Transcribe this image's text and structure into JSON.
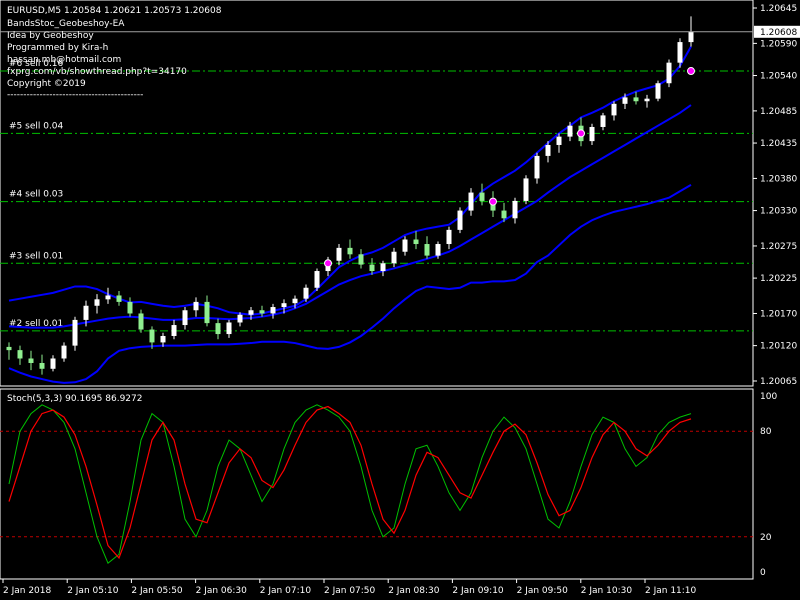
{
  "header": {
    "symbol_line": "EURUSD,M5  1.20584 1.20621 1.20573 1.20608",
    "ea_name": "BandsStoc_Geobeshoy-EA",
    "idea": "Idea by Geobeshoy",
    "programmer": "Programmed by Kira-h",
    "email": "hassan.mb@hotmail.com",
    "forum_link": "fxprg.com/vb/showthread.php?t=34170",
    "copyright": "Copyright ©2019",
    "separator": "------------------------------------------"
  },
  "current_price_label": "1.20608",
  "price_axis_labels": [
    "1.20645",
    "1.20590",
    "1.20540",
    "1.20485",
    "1.20435",
    "1.20380",
    "1.20330",
    "1.20275",
    "1.20225",
    "1.20170",
    "1.20120",
    "1.20065"
  ],
  "sell_levels": [
    {
      "label": "#6 sell 0.16",
      "price": 1.20547
    },
    {
      "label": "#5 sell 0.04",
      "price": 1.2045
    },
    {
      "label": "#4 sell 0.03",
      "price": 1.20344
    },
    {
      "label": "#3 sell 0.01",
      "price": 1.20248
    },
    {
      "label": "#2 sell 0.01",
      "price": 1.20143
    }
  ],
  "indicator": {
    "title": "Stoch(5,3,3) 90.1695 86.9272",
    "axis_labels": [
      "100",
      "80",
      "20",
      "0"
    ],
    "levels": [
      80,
      20
    ]
  },
  "time_axis_labels": [
    "2 Jan 2018",
    "2 Jan 05:10",
    "2 Jan 05:50",
    "2 Jan 06:30",
    "2 Jan 07:10",
    "2 Jan 07:50",
    "2 Jan 08:30",
    "2 Jan 09:10",
    "2 Jan 09:50",
    "2 Jan 10:30",
    "2 Jan 11:10"
  ],
  "colors": {
    "background": "#000000",
    "bull_candle": "#ffffff",
    "bear_candle": "#90ee90",
    "bands": "#0000ff",
    "levels": "#00c000",
    "stoch_main": "#00c000",
    "stoch_signal": "#ff0000",
    "signal_marker": "#ff00ff"
  },
  "chart_data": {
    "type": "candlestick",
    "candles": [
      {
        "o": 1.20118,
        "h": 1.20125,
        "l": 1.20098,
        "c": 1.20113
      },
      {
        "o": 1.20113,
        "h": 1.2012,
        "l": 1.2009,
        "c": 1.201
      },
      {
        "o": 1.201,
        "h": 1.20112,
        "l": 1.20082,
        "c": 1.20093
      },
      {
        "o": 1.20093,
        "h": 1.20106,
        "l": 1.20075,
        "c": 1.20084
      },
      {
        "o": 1.20084,
        "h": 1.20105,
        "l": 1.2008,
        "c": 1.201
      },
      {
        "o": 1.201,
        "h": 1.20125,
        "l": 1.20095,
        "c": 1.2012
      },
      {
        "o": 1.2012,
        "h": 1.20165,
        "l": 1.20112,
        "c": 1.2016
      },
      {
        "o": 1.2016,
        "h": 1.2019,
        "l": 1.2015,
        "c": 1.20182
      },
      {
        "o": 1.20182,
        "h": 1.202,
        "l": 1.2017,
        "c": 1.20192
      },
      {
        "o": 1.20192,
        "h": 1.2021,
        "l": 1.20185,
        "c": 1.20198
      },
      {
        "o": 1.20198,
        "h": 1.20205,
        "l": 1.20182,
        "c": 1.20188
      },
      {
        "o": 1.20188,
        "h": 1.20195,
        "l": 1.20165,
        "c": 1.2017
      },
      {
        "o": 1.2017,
        "h": 1.20176,
        "l": 1.2014,
        "c": 1.20145
      },
      {
        "o": 1.20145,
        "h": 1.2015,
        "l": 1.20115,
        "c": 1.20125
      },
      {
        "o": 1.20125,
        "h": 1.2014,
        "l": 1.20118,
        "c": 1.20135
      },
      {
        "o": 1.20135,
        "h": 1.2016,
        "l": 1.2013,
        "c": 1.20152
      },
      {
        "o": 1.20152,
        "h": 1.2018,
        "l": 1.20145,
        "c": 1.20175
      },
      {
        "o": 1.20175,
        "h": 1.20195,
        "l": 1.20165,
        "c": 1.20188
      },
      {
        "o": 1.20188,
        "h": 1.20198,
        "l": 1.2015,
        "c": 1.20155
      },
      {
        "o": 1.20155,
        "h": 1.20162,
        "l": 1.2013,
        "c": 1.20138
      },
      {
        "o": 1.20138,
        "h": 1.2016,
        "l": 1.20132,
        "c": 1.20156
      },
      {
        "o": 1.20156,
        "h": 1.20172,
        "l": 1.2015,
        "c": 1.20168
      },
      {
        "o": 1.20168,
        "h": 1.2018,
        "l": 1.2016,
        "c": 1.20175
      },
      {
        "o": 1.20175,
        "h": 1.20182,
        "l": 1.20165,
        "c": 1.2017
      },
      {
        "o": 1.2017,
        "h": 1.20185,
        "l": 1.20162,
        "c": 1.2018
      },
      {
        "o": 1.2018,
        "h": 1.20192,
        "l": 1.2017,
        "c": 1.20186
      },
      {
        "o": 1.20186,
        "h": 1.20198,
        "l": 1.20178,
        "c": 1.20193
      },
      {
        "o": 1.20193,
        "h": 1.20215,
        "l": 1.20188,
        "c": 1.2021
      },
      {
        "o": 1.2021,
        "h": 1.2024,
        "l": 1.20205,
        "c": 1.20236
      },
      {
        "o": 1.20236,
        "h": 1.20258,
        "l": 1.20228,
        "c": 1.20252
      },
      {
        "o": 1.20252,
        "h": 1.20278,
        "l": 1.20245,
        "c": 1.20272
      },
      {
        "o": 1.20272,
        "h": 1.20285,
        "l": 1.20255,
        "c": 1.20262
      },
      {
        "o": 1.20262,
        "h": 1.2027,
        "l": 1.2024,
        "c": 1.20246
      },
      {
        "o": 1.20246,
        "h": 1.20256,
        "l": 1.2023,
        "c": 1.20236
      },
      {
        "o": 1.20236,
        "h": 1.20252,
        "l": 1.20228,
        "c": 1.20248
      },
      {
        "o": 1.20248,
        "h": 1.20272,
        "l": 1.20242,
        "c": 1.20266
      },
      {
        "o": 1.20266,
        "h": 1.2029,
        "l": 1.2026,
        "c": 1.20285
      },
      {
        "o": 1.20285,
        "h": 1.20298,
        "l": 1.2027,
        "c": 1.20278
      },
      {
        "o": 1.20278,
        "h": 1.2029,
        "l": 1.20255,
        "c": 1.2026
      },
      {
        "o": 1.2026,
        "h": 1.20282,
        "l": 1.20255,
        "c": 1.20278
      },
      {
        "o": 1.20278,
        "h": 1.20305,
        "l": 1.2027,
        "c": 1.203
      },
      {
        "o": 1.203,
        "h": 1.20335,
        "l": 1.20295,
        "c": 1.2033
      },
      {
        "o": 1.2033,
        "h": 1.20365,
        "l": 1.20322,
        "c": 1.20358
      },
      {
        "o": 1.20358,
        "h": 1.20372,
        "l": 1.20338,
        "c": 1.20345
      },
      {
        "o": 1.20345,
        "h": 1.2036,
        "l": 1.2032,
        "c": 1.2033
      },
      {
        "o": 1.2033,
        "h": 1.20342,
        "l": 1.20312,
        "c": 1.20318
      },
      {
        "o": 1.20318,
        "h": 1.2035,
        "l": 1.2031,
        "c": 1.20345
      },
      {
        "o": 1.20345,
        "h": 1.20385,
        "l": 1.2034,
        "c": 1.2038
      },
      {
        "o": 1.2038,
        "h": 1.2042,
        "l": 1.20372,
        "c": 1.20415
      },
      {
        "o": 1.20415,
        "h": 1.20438,
        "l": 1.20405,
        "c": 1.20432
      },
      {
        "o": 1.20432,
        "h": 1.2045,
        "l": 1.2042,
        "c": 1.20445
      },
      {
        "o": 1.20445,
        "h": 1.20468,
        "l": 1.20438,
        "c": 1.20462
      },
      {
        "o": 1.20462,
        "h": 1.20475,
        "l": 1.2043,
        "c": 1.20438
      },
      {
        "o": 1.20438,
        "h": 1.20465,
        "l": 1.20432,
        "c": 1.2046
      },
      {
        "o": 1.2046,
        "h": 1.20482,
        "l": 1.20455,
        "c": 1.20478
      },
      {
        "o": 1.20478,
        "h": 1.205,
        "l": 1.2047,
        "c": 1.20496
      },
      {
        "o": 1.20496,
        "h": 1.20512,
        "l": 1.20488,
        "c": 1.20506
      },
      {
        "o": 1.20506,
        "h": 1.20515,
        "l": 1.20495,
        "c": 1.205
      },
      {
        "o": 1.205,
        "h": 1.2051,
        "l": 1.2049,
        "c": 1.20504
      },
      {
        "o": 1.20504,
        "h": 1.20532,
        "l": 1.205,
        "c": 1.20528
      },
      {
        "o": 1.20528,
        "h": 1.20565,
        "l": 1.20522,
        "c": 1.2056
      },
      {
        "o": 1.2056,
        "h": 1.20598,
        "l": 1.20552,
        "c": 1.20592
      },
      {
        "o": 1.20592,
        "h": 1.20632,
        "l": 1.20585,
        "c": 1.20608
      }
    ],
    "bands_upper": [
      1.2019,
      1.20193,
      1.20196,
      1.20199,
      1.20202,
      1.20207,
      1.20212,
      1.20212,
      1.20208,
      1.202,
      1.20193,
      1.20187,
      1.20188,
      1.20185,
      1.20182,
      1.2018,
      1.20182,
      1.20185,
      1.20182,
      1.20178,
      1.20172,
      1.2017,
      1.20168,
      1.2017,
      1.20174,
      1.20178,
      1.20182,
      1.20192,
      1.20208,
      1.20225,
      1.20242,
      1.20252,
      1.2026,
      1.20265,
      1.20272,
      1.20282,
      1.20292,
      1.20298,
      1.20302,
      1.20305,
      1.20308,
      1.2032,
      1.2034,
      1.2036,
      1.20372,
      1.20382,
      1.20392,
      1.20405,
      1.2042,
      1.20435,
      1.2045,
      1.20462,
      1.20475,
      1.20482,
      1.2049,
      1.205,
      1.20508,
      1.20515,
      1.2052,
      1.20525,
      1.20535,
      1.20555,
      1.20585
    ],
    "bands_middle": [
      1.2015,
      1.20149,
      1.20148,
      1.20148,
      1.20148,
      1.2015,
      1.20153,
      1.20156,
      1.20159,
      1.20162,
      1.20164,
      1.20165,
      1.20164,
      1.20162,
      1.2016,
      1.2016,
      1.20161,
      1.20163,
      1.20163,
      1.20162,
      1.20161,
      1.20162,
      1.20163,
      1.20165,
      1.20168,
      1.20172,
      1.20178,
      1.20185,
      1.20195,
      1.20205,
      1.20215,
      1.20222,
      1.20228,
      1.20232,
      1.20236,
      1.2024,
      1.20245,
      1.2025,
      1.20255,
      1.2026,
      1.20266,
      1.20275,
      1.20285,
      1.20295,
      1.20305,
      1.20315,
      1.20325,
      1.20335,
      1.20345,
      1.20358,
      1.2037,
      1.20382,
      1.20392,
      1.20402,
      1.20412,
      1.20422,
      1.20432,
      1.20442,
      1.20452,
      1.20462,
      1.20472,
      1.20482,
      1.20494
    ],
    "bands_lower": [
      1.20085,
      1.20078,
      1.20072,
      1.20068,
      1.20064,
      1.20062,
      1.20063,
      1.20068,
      1.2008,
      1.201,
      1.20112,
      1.20116,
      1.20118,
      1.20119,
      1.2012,
      1.2012,
      1.2012,
      1.20121,
      1.20122,
      1.20122,
      1.20122,
      1.20123,
      1.20124,
      1.20126,
      1.20126,
      1.20126,
      1.20124,
      1.2012,
      1.20116,
      1.20115,
      1.20118,
      1.20125,
      1.20135,
      1.20148,
      1.20162,
      1.20178,
      1.20192,
      1.20205,
      1.20212,
      1.2021,
      1.20208,
      1.2021,
      1.20218,
      1.20218,
      1.2022,
      1.2022,
      1.20222,
      1.20232,
      1.2025,
      1.2026,
      1.20276,
      1.20292,
      1.20305,
      1.20315,
      1.20322,
      1.20328,
      1.20332,
      1.20336,
      1.2034,
      1.20345,
      1.2035,
      1.2036,
      1.2037
    ],
    "markers": [
      {
        "index": 29,
        "price": 1.20248
      },
      {
        "index": 44,
        "price": 1.20344
      },
      {
        "index": 52,
        "price": 1.2045
      },
      {
        "index": 62,
        "price": 1.20547
      }
    ],
    "stoch_main": [
      50,
      80,
      90,
      95,
      92,
      85,
      70,
      45,
      20,
      5,
      10,
      40,
      75,
      90,
      85,
      60,
      30,
      20,
      35,
      60,
      75,
      70,
      55,
      40,
      50,
      70,
      85,
      92,
      95,
      92,
      88,
      80,
      60,
      35,
      20,
      25,
      50,
      70,
      72,
      60,
      45,
      35,
      45,
      65,
      80,
      88,
      82,
      70,
      50,
      30,
      25,
      40,
      60,
      78,
      88,
      85,
      70,
      60,
      65,
      78,
      85,
      88,
      90
    ],
    "stoch_signal": [
      40,
      60,
      80,
      90,
      92,
      88,
      78,
      60,
      38,
      15,
      8,
      25,
      50,
      75,
      85,
      75,
      50,
      30,
      28,
      45,
      62,
      70,
      65,
      52,
      48,
      58,
      72,
      85,
      92,
      94,
      90,
      85,
      72,
      50,
      30,
      22,
      35,
      55,
      68,
      65,
      55,
      45,
      42,
      55,
      68,
      80,
      84,
      78,
      62,
      44,
      32,
      35,
      48,
      65,
      78,
      85,
      80,
      70,
      66,
      72,
      80,
      85,
      87
    ]
  }
}
